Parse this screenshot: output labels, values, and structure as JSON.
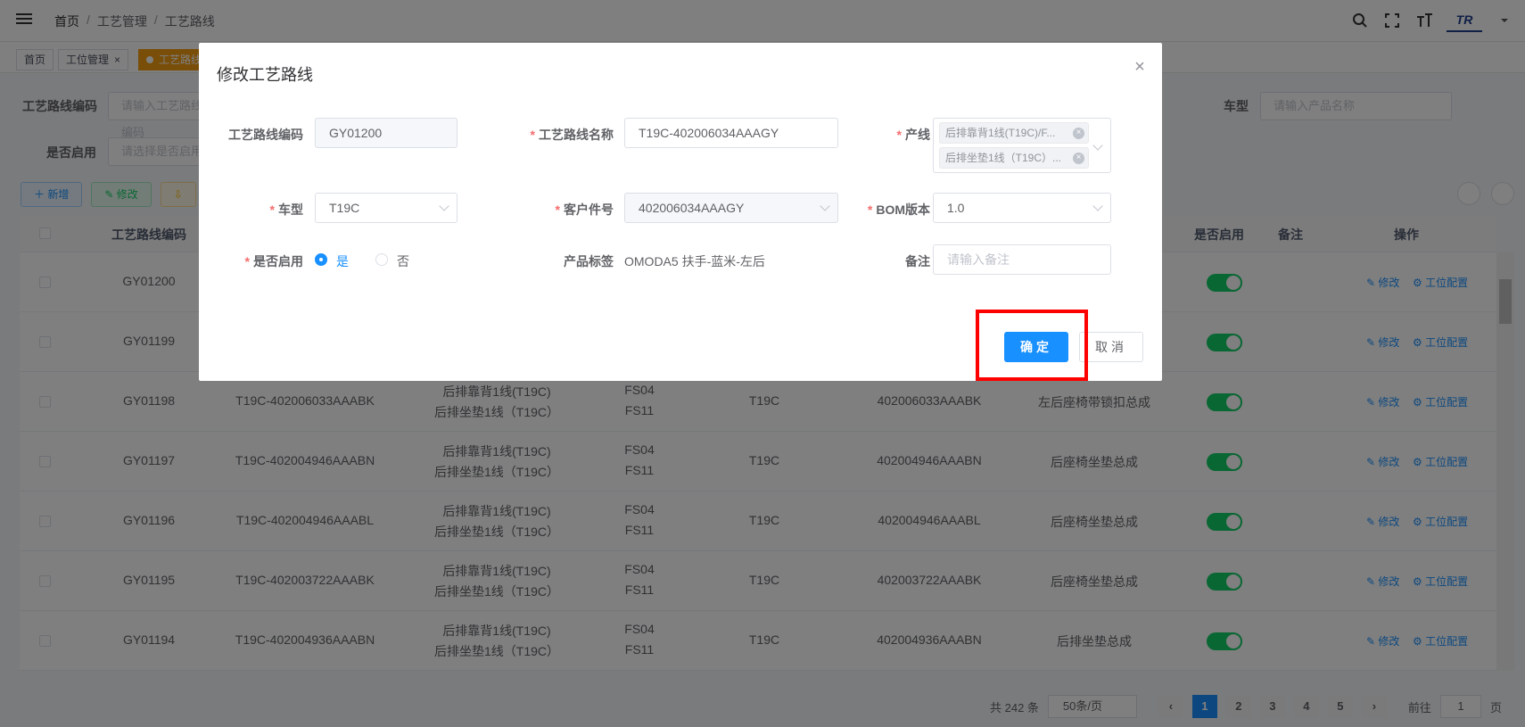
{
  "header": {
    "breadcrumb": [
      "首页",
      "工艺管理",
      "工艺路线"
    ]
  },
  "tags": [
    {
      "label": "首页"
    },
    {
      "label": "工位管理"
    },
    {
      "label": "工艺路线"
    }
  ],
  "search": {
    "code_label": "工艺路线编码",
    "code_placeholder": "请输入工艺路线编码",
    "enabled_label": "是否启用",
    "enabled_placeholder": "请选择是否启用",
    "model_label": "车型",
    "model_placeholder": "请输入产品名称"
  },
  "toolbar": {
    "add": "＋ 新增",
    "edit": "✎ 修改",
    "export": "⇩"
  },
  "table": {
    "headers": {
      "code": "工艺路线编码",
      "enabled": "是否启用",
      "remark": "备注",
      "action": "操作"
    },
    "action_edit": "修改",
    "action_station": "工位配置",
    "rows": [
      {
        "code": "GY01200",
        "name": "",
        "line1": "",
        "line2": "",
        "fs1": "",
        "fs2": "",
        "model": "",
        "part": "",
        "desc": "",
        "enabled": true
      },
      {
        "code": "GY01199",
        "name": "",
        "line1": "",
        "line2": "",
        "fs1": "",
        "fs2": "",
        "model": "",
        "part": "",
        "desc": "",
        "enabled": true
      },
      {
        "code": "GY01198",
        "name": "T19C-402006033AAABK",
        "line1": "后排靠背1线(T19C)",
        "line2": "后排坐垫1线（T19C）",
        "fs1": "FS04",
        "fs2": "FS11",
        "model": "T19C",
        "part": "402006033AAABK",
        "desc": "左后座椅带锁扣总成",
        "enabled": true
      },
      {
        "code": "GY01197",
        "name": "T19C-402004946AAABN",
        "line1": "后排靠背1线(T19C)",
        "line2": "后排坐垫1线（T19C）",
        "fs1": "FS04",
        "fs2": "FS11",
        "model": "T19C",
        "part": "402004946AAABN",
        "desc": "后座椅坐垫总成",
        "enabled": true
      },
      {
        "code": "GY01196",
        "name": "T19C-402004946AAABL",
        "line1": "后排靠背1线(T19C)",
        "line2": "后排坐垫1线（T19C）",
        "fs1": "FS04",
        "fs2": "FS11",
        "model": "T19C",
        "part": "402004946AAABL",
        "desc": "后座椅坐垫总成",
        "enabled": true
      },
      {
        "code": "GY01195",
        "name": "T19C-402003722AAABK",
        "line1": "后排靠背1线(T19C)",
        "line2": "后排坐垫1线（T19C）",
        "fs1": "FS04",
        "fs2": "FS11",
        "model": "T19C",
        "part": "402003722AAABK",
        "desc": "后座椅坐垫总成",
        "enabled": true
      },
      {
        "code": "GY01194",
        "name": "T19C-402004936AAABN",
        "line1": "后排靠背1线(T19C)",
        "line2": "后排坐垫1线（T19C）",
        "fs1": "FS04",
        "fs2": "FS11",
        "model": "T19C",
        "part": "402004936AAABN",
        "desc": "后排坐垫总成",
        "enabled": true
      }
    ]
  },
  "pager": {
    "total": "共 242 条",
    "size": "50条/页",
    "pages": [
      "1",
      "2",
      "3",
      "4",
      "5"
    ],
    "current": "1",
    "goto": "前往",
    "page_unit": "页",
    "goto_value": "1",
    "prev": "‹",
    "next": "›"
  },
  "modal": {
    "title": "修改工艺路线",
    "code_label": "工艺路线编码",
    "code_value": "GY01200",
    "name_label": "工艺路线名称",
    "name_value": "T19C-402006034AAAGY",
    "line_label": "产线",
    "line_chips": [
      "后排靠背1线(T19C)/F...",
      "后排坐垫1线（T19C）..."
    ],
    "model_label": "车型",
    "model_value": "T19C",
    "part_label": "客户件号",
    "part_value": "402006034AAAGY",
    "bom_label": "BOM版本",
    "bom_value": "1.0",
    "enabled_label": "是否启用",
    "yes": "是",
    "no": "否",
    "tag_label": "产品标签",
    "tag_value": "OMODA5 扶手-蓝米-左后",
    "remark_label": "备注",
    "remark_placeholder": "请输入备注",
    "ok": "确定",
    "cancel": "取消"
  },
  "colors": {
    "primary": "#1890ff",
    "switch_on": "#13ce66",
    "active_tag": "#f39c12",
    "highlight": "#ff0000"
  }
}
